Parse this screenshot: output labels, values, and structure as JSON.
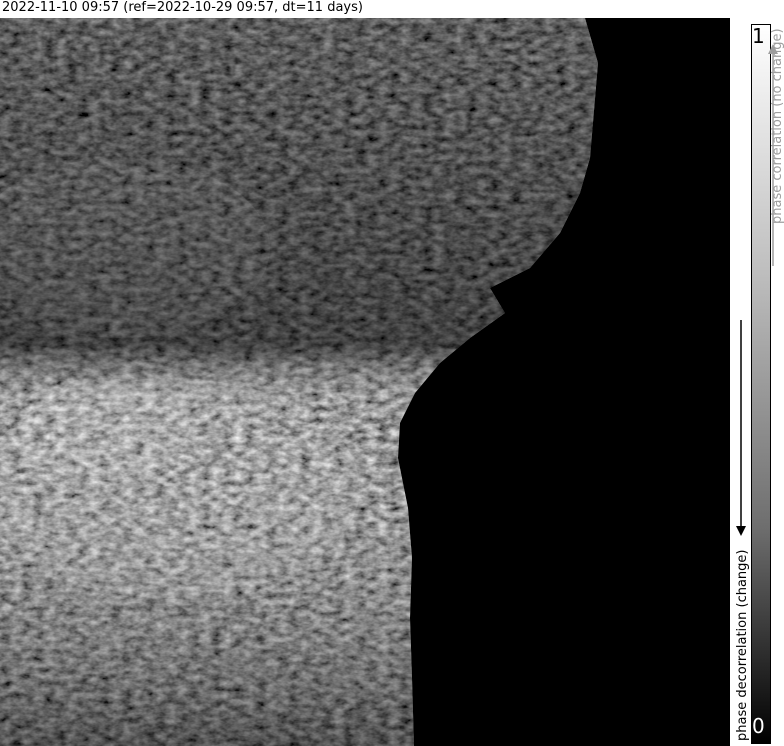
{
  "title": "2022-11-10 09:57 (ref=2022-10-29 09:57, dt=11 days)",
  "colorbar": {
    "max_label": "1",
    "min_label": "0",
    "top_label": "phase correlation (no change)",
    "bottom_label": "phase decorrelation (change)",
    "gradient": [
      "#ffffff",
      "#000000"
    ]
  },
  "image": {
    "description_colors": {
      "background": "#000000"
    }
  }
}
